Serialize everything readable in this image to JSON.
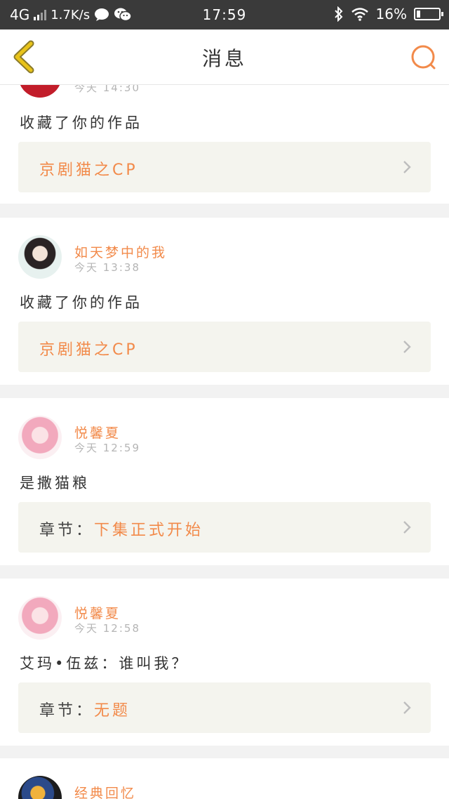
{
  "status_bar": {
    "network": "4G",
    "speed": "1.7K/s",
    "time": "17:59",
    "battery": "16%",
    "battery_level": 0.16
  },
  "header": {
    "title": "消息"
  },
  "messages": [
    {
      "time": "今天 14:30",
      "text": "收藏了你的作品",
      "ref_prefix": "",
      "ref_title": "京剧猫之CP"
    },
    {
      "username": "如天梦中的我",
      "time": "今天 13:38",
      "text": "收藏了你的作品",
      "ref_prefix": "",
      "ref_title": "京剧猫之CP"
    },
    {
      "username": "悦馨夏",
      "time": "今天 12:59",
      "text": "是撒猫粮",
      "ref_prefix": "章节：",
      "ref_title": "下集正式开始"
    },
    {
      "username": "悦馨夏",
      "time": "今天 12:58",
      "text": "艾玛•伍兹：谁叫我？",
      "ref_prefix": "章节：",
      "ref_title": "无题"
    },
    {
      "username": "经典回忆"
    }
  ],
  "colors": {
    "accent": "#f28a4a",
    "back_icon": "#d4b100",
    "status_bar_bg": "#3a3a3a"
  }
}
